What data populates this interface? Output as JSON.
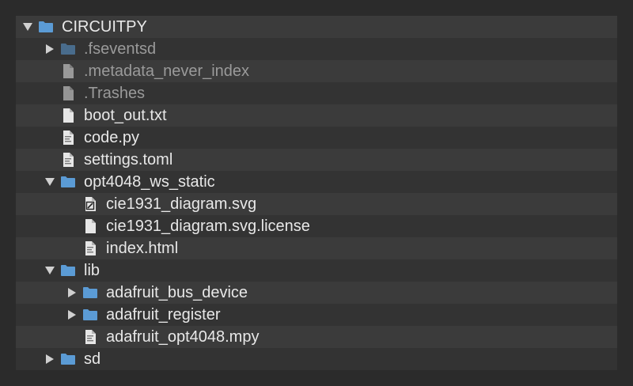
{
  "tree": {
    "items": [
      {
        "name": "CIRCUITPY",
        "kind": "folder",
        "twisty": "expanded",
        "dim": false
      },
      {
        "name": ".fseventsd",
        "kind": "folder",
        "twisty": "collapsed",
        "dim": true
      },
      {
        "name": ".metadata_never_index",
        "kind": "file",
        "twisty": "none",
        "dim": true
      },
      {
        "name": ".Trashes",
        "kind": "file",
        "twisty": "none",
        "dim": true
      },
      {
        "name": "boot_out.txt",
        "kind": "file",
        "twisty": "none",
        "dim": false
      },
      {
        "name": "code.py",
        "kind": "code-file",
        "twisty": "none",
        "dim": false
      },
      {
        "name": "settings.toml",
        "kind": "code-file",
        "twisty": "none",
        "dim": false
      },
      {
        "name": "opt4048_ws_static",
        "kind": "folder",
        "twisty": "expanded",
        "dim": false
      },
      {
        "name": "cie1931_diagram.svg",
        "kind": "image-file",
        "twisty": "none",
        "dim": false
      },
      {
        "name": "cie1931_diagram.svg.license",
        "kind": "file",
        "twisty": "none",
        "dim": false
      },
      {
        "name": "index.html",
        "kind": "code-file",
        "twisty": "none",
        "dim": false
      },
      {
        "name": "lib",
        "kind": "folder",
        "twisty": "expanded",
        "dim": false
      },
      {
        "name": "adafruit_bus_device",
        "kind": "folder",
        "twisty": "collapsed",
        "dim": false
      },
      {
        "name": "adafruit_register",
        "kind": "folder",
        "twisty": "collapsed",
        "dim": false
      },
      {
        "name": "adafruit_opt4048.mpy",
        "kind": "code-file",
        "twisty": "none",
        "dim": false
      },
      {
        "name": "sd",
        "kind": "folder",
        "twisty": "collapsed",
        "dim": false
      }
    ]
  },
  "colors": {
    "background": "#2b2b2b",
    "panel": "#333333",
    "row_alt": "#3b3b3b",
    "folder": "#5b9bd5",
    "text": "#e8e8e8",
    "text_dim": "#9a9a9a"
  }
}
